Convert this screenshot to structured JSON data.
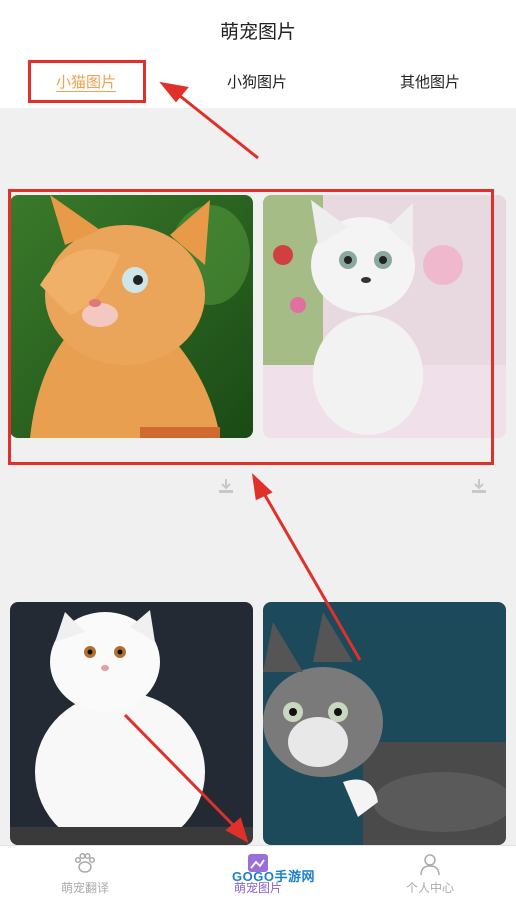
{
  "header": {
    "title": "萌宠图片"
  },
  "tabs": [
    {
      "label": "小猫图片",
      "active": true
    },
    {
      "label": "小狗图片",
      "active": false
    },
    {
      "label": "其他图片",
      "active": false
    }
  ],
  "gallery": {
    "items": [
      {
        "name": "orange-kitten-photo",
        "icon": "download-icon"
      },
      {
        "name": "white-kitten-photo",
        "icon": "download-icon"
      },
      {
        "name": "persian-cat-photo",
        "icon": "download-icon"
      },
      {
        "name": "tabby-kitten-photo",
        "icon": "download-icon"
      }
    ]
  },
  "bottom_nav": {
    "items": [
      {
        "label": "萌宠翻译",
        "icon": "paw-icon"
      },
      {
        "label": "萌宠图片",
        "icon": "image-icon",
        "active": true
      },
      {
        "label": "个人中心",
        "icon": "person-icon"
      }
    ]
  },
  "watermark": {
    "text": "GOGO手游网"
  },
  "colors": {
    "accent": "#f0a050",
    "annotation": "#e0302a",
    "active_nav": "#8a5fd0"
  }
}
